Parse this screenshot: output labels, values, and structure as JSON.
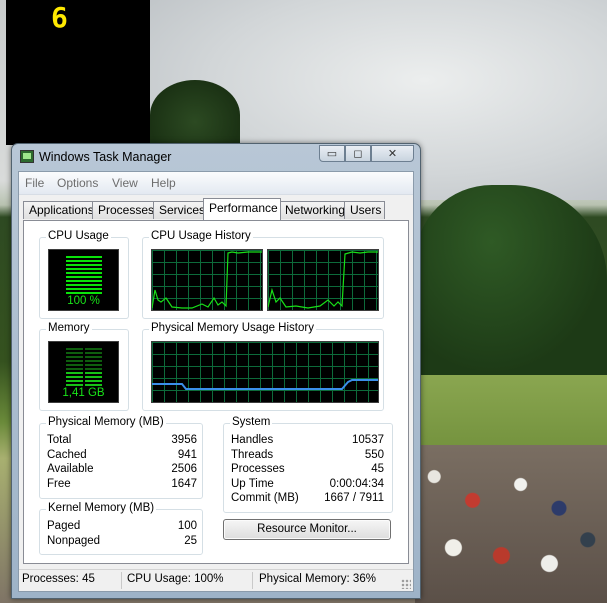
{
  "gadget": {
    "value": "6"
  },
  "window": {
    "title": "Windows Task Manager",
    "caption": {
      "minimize": "▭",
      "maximize": "◻",
      "close": "✕"
    }
  },
  "menu": [
    "File",
    "Options",
    "View",
    "Help"
  ],
  "tabs": [
    "Applications",
    "Processes",
    "Services",
    "Performance",
    "Networking",
    "Users"
  ],
  "active_tab": "Performance",
  "performance": {
    "cpu_usage": {
      "title": "CPU Usage",
      "value": "100 %",
      "level": 1.0
    },
    "cpu_history": {
      "title": "CPU Usage History"
    },
    "memory": {
      "title": "Memory",
      "value": "1,41 GB",
      "level": 0.36
    },
    "memory_history": {
      "title": "Physical Memory Usage History"
    },
    "physical_memory": {
      "title": "Physical Memory (MB)",
      "rows": [
        {
          "label": "Total",
          "value": "3956"
        },
        {
          "label": "Cached",
          "value": "941"
        },
        {
          "label": "Available",
          "value": "2506"
        },
        {
          "label": "Free",
          "value": "1647"
        }
      ]
    },
    "system": {
      "title": "System",
      "rows": [
        {
          "label": "Handles",
          "value": "10537"
        },
        {
          "label": "Threads",
          "value": "550"
        },
        {
          "label": "Processes",
          "value": "45"
        },
        {
          "label": "Up Time",
          "value": "0:00:04:34"
        },
        {
          "label": "Commit (MB)",
          "value": "1667 / 7911"
        }
      ]
    },
    "kernel_memory": {
      "title": "Kernel Memory (MB)",
      "rows": [
        {
          "label": "Paged",
          "value": "100"
        },
        {
          "label": "Nonpaged",
          "value": "25"
        }
      ]
    },
    "resource_monitor_label": "Resource Monitor..."
  },
  "status": {
    "processes": "Processes: 45",
    "cpu": "CPU Usage: 100%",
    "memory": "Physical Memory: 36%"
  },
  "colors": {
    "graph_line": "#18e018",
    "grid": "#0d6a3a",
    "memory_line": "#3b8eea",
    "gadget_text": "#ffe900"
  }
}
